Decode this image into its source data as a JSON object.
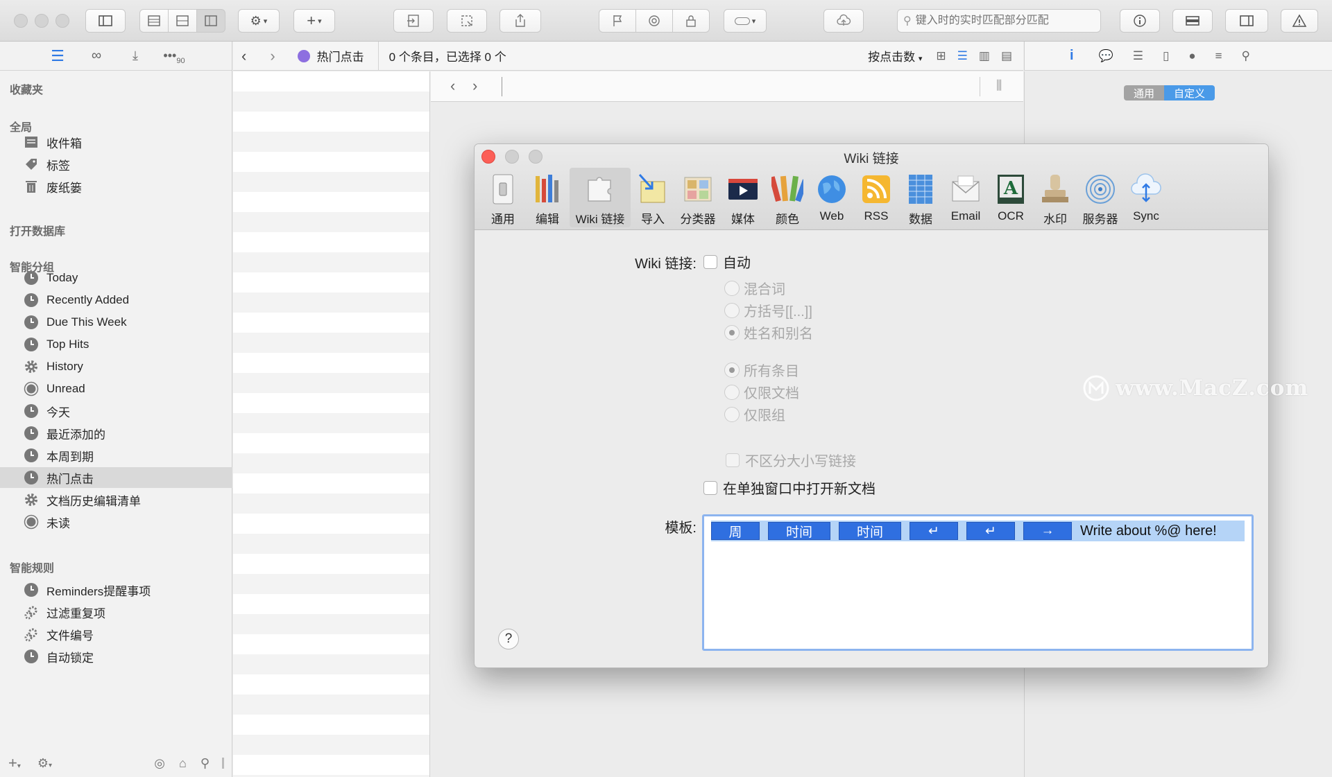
{
  "toolbar": {
    "search_placeholder": "键入时的实时匹配部分匹配"
  },
  "sidebar": {
    "sections": {
      "favorites": "收藏夹",
      "global": "全局",
      "open_db": "打开数据库",
      "smart_groups": "智能分组",
      "smart_rules": "智能规则"
    },
    "global_items": [
      {
        "label": "收件箱",
        "icon": "inbox-icon"
      },
      {
        "label": "标签",
        "icon": "tag-icon"
      },
      {
        "label": "废纸篓",
        "icon": "trash-icon"
      }
    ],
    "smart_groups": [
      {
        "label": "Today",
        "icon": "clock-icon"
      },
      {
        "label": "Recently Added",
        "icon": "clock-icon"
      },
      {
        "label": "Due This Week",
        "icon": "clock-icon"
      },
      {
        "label": "Top Hits",
        "icon": "clock-icon"
      },
      {
        "label": "History",
        "icon": "gear-icon"
      },
      {
        "label": "Unread",
        "icon": "circle-icon"
      },
      {
        "label": "今天",
        "icon": "clock-icon"
      },
      {
        "label": "最近添加的",
        "icon": "clock-icon"
      },
      {
        "label": "本周到期",
        "icon": "clock-icon"
      },
      {
        "label": "热门点击",
        "icon": "clock-icon",
        "selected": true
      },
      {
        "label": "文档历史编辑清单",
        "icon": "gear-icon"
      },
      {
        "label": "未读",
        "icon": "circle-icon"
      }
    ],
    "smart_rules": [
      {
        "label": "Reminders提醒事项",
        "icon": "clock-icon"
      },
      {
        "label": "过滤重复项",
        "icon": "gears-icon"
      },
      {
        "label": "文件编号",
        "icon": "gears-icon"
      },
      {
        "label": "自动锁定",
        "icon": "clock-icon"
      }
    ],
    "top_badge": "90"
  },
  "pathbar": {
    "current_group": "热门点击",
    "status": "0 个条目，已选择 0 个",
    "sort": "按点击数"
  },
  "inspector": {
    "tab_general": "通用",
    "tab_custom": "自定义"
  },
  "dialog": {
    "title": "Wiki 链接",
    "prefs": [
      {
        "label": "通用",
        "icon": "switch-icon"
      },
      {
        "label": "编辑",
        "icon": "pencils-icon"
      },
      {
        "label": "Wiki 链接",
        "icon": "puzzle-icon",
        "active": true
      },
      {
        "label": "导入",
        "icon": "import-icon"
      },
      {
        "label": "分类器",
        "icon": "classifier-icon"
      },
      {
        "label": "媒体",
        "icon": "media-icon"
      },
      {
        "label": "颜色",
        "icon": "palette-icon"
      },
      {
        "label": "Web",
        "icon": "globe-icon"
      },
      {
        "label": "RSS",
        "icon": "rss-icon"
      },
      {
        "label": "数据",
        "icon": "data-icon"
      },
      {
        "label": "Email",
        "icon": "email-icon"
      },
      {
        "label": "OCR",
        "icon": "ocr-icon"
      },
      {
        "label": "水印",
        "icon": "stamp-icon"
      },
      {
        "label": "服务器",
        "icon": "server-icon"
      },
      {
        "label": "Sync",
        "icon": "sync-icon"
      }
    ],
    "wiki_label": "Wiki 链接:",
    "auto_label": "自动",
    "radio_group1": [
      "混合词",
      "方括号[[...]]",
      "姓名和别名"
    ],
    "radio_group1_selected": 2,
    "radio_group2": [
      "所有条目",
      "仅限文档",
      "仅限组"
    ],
    "radio_group2_selected": 0,
    "case_insensitive": "不区分大小写链接",
    "open_new_window": "在单独窗口中打开新文档",
    "template_label": "模板:",
    "template_tokens": [
      "周",
      "时间",
      "时间",
      "↵",
      "↵",
      "→"
    ],
    "template_text": "Write about %@ here!",
    "help": "?"
  },
  "watermark": "www.MacZ.com"
}
